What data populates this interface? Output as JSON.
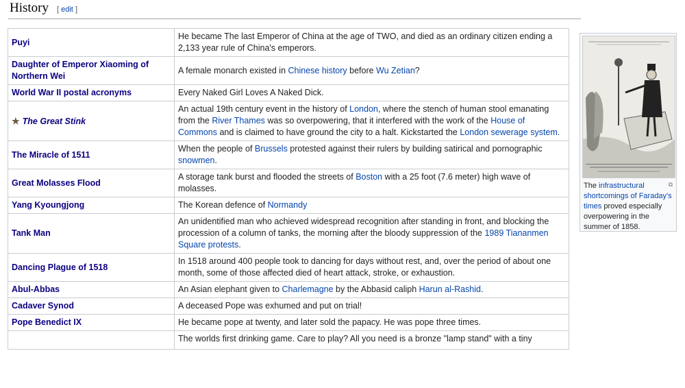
{
  "section": {
    "title": "History",
    "edit_open": "[",
    "edit_label": "edit",
    "edit_close": "]"
  },
  "rows": [
    {
      "name": "Puyi",
      "desc": [
        {
          "t": "He became The last Emperor of China at the age of TWO, and died as an ordinary citizen ending a 2,133 year rule of China's emperors."
        }
      ]
    },
    {
      "name": "Daughter of Emperor Xiaoming of Northern Wei",
      "desc": [
        {
          "t": "A female monarch existed in "
        },
        {
          "t": "Chinese history",
          "link": true
        },
        {
          "t": " before "
        },
        {
          "t": "Wu Zetian",
          "link": true
        },
        {
          "t": "?"
        }
      ]
    },
    {
      "name": "World War II postal acronyms",
      "desc": [
        {
          "t": "Every Naked Girl Loves A Naked Dick."
        }
      ]
    },
    {
      "name": "The Great Stink",
      "featured": true,
      "desc": [
        {
          "t": "An actual 19th century event in the history of "
        },
        {
          "t": "London",
          "link": true
        },
        {
          "t": ", where the stench of human stool emanating from the "
        },
        {
          "t": "River Thames",
          "link": true
        },
        {
          "t": " was so overpowering, that it interfered with the work of the "
        },
        {
          "t": "House of Commons",
          "link": true
        },
        {
          "t": " and is claimed to have ground the city to a halt. Kickstarted the "
        },
        {
          "t": "London sewerage system",
          "link": true
        },
        {
          "t": "."
        }
      ]
    },
    {
      "name": "The Miracle of 1511",
      "desc": [
        {
          "t": "When the people of "
        },
        {
          "t": "Brussels",
          "link": true
        },
        {
          "t": " protested against their rulers by building satirical and pornographic "
        },
        {
          "t": "snowmen",
          "link": true
        },
        {
          "t": "."
        }
      ]
    },
    {
      "name": "Great Molasses Flood",
      "desc": [
        {
          "t": "A storage tank burst and flooded the streets of "
        },
        {
          "t": "Boston",
          "link": true
        },
        {
          "t": " with a 25 foot (7.6 meter) high wave of molasses."
        }
      ]
    },
    {
      "name": "Yang Kyoungjong",
      "desc": [
        {
          "t": "The Korean defence of "
        },
        {
          "t": "Normandy",
          "link": true
        }
      ]
    },
    {
      "name": "Tank Man",
      "desc": [
        {
          "t": "An unidentified man who achieved widespread recognition after standing in front, and blocking the procession of a column of tanks, the morning after the bloody suppression of the "
        },
        {
          "t": "1989 Tiananmen Square protests",
          "link": true
        },
        {
          "t": "."
        }
      ]
    },
    {
      "name": "Dancing Plague of 1518",
      "desc": [
        {
          "t": "In 1518 around 400 people took to dancing for days without rest, and, over the period of about one month, some of those affected died of heart attack, stroke, or exhaustion."
        }
      ]
    },
    {
      "name": "Abul-Abbas",
      "desc": [
        {
          "t": "An Asian elephant given to "
        },
        {
          "t": "Charlemagne",
          "link": true
        },
        {
          "t": " by the Abbasid caliph "
        },
        {
          "t": "Harun al-Rashid",
          "link": true
        },
        {
          "t": "."
        }
      ]
    },
    {
      "name": "Cadaver Synod",
      "desc": [
        {
          "t": "A deceased Pope was exhumed and put on trial!"
        }
      ]
    },
    {
      "name": "Pope Benedict IX",
      "desc": [
        {
          "t": "He became pope at twenty, and later sold the papacy. He was pope three times."
        }
      ]
    },
    {
      "name": "",
      "desc": [
        {
          "t": "The worlds first drinking game. Care to play? All you need is a bronze \"lamp stand\" with a tiny"
        }
      ]
    }
  ],
  "figure": {
    "caption": [
      {
        "t": "The "
      },
      {
        "t": "infrastructural shortcomings of Faraday's times",
        "link": true
      },
      {
        "t": " proved especially overpowering in the summer of 1858."
      }
    ],
    "magnify_icon": "magnify-icon"
  }
}
